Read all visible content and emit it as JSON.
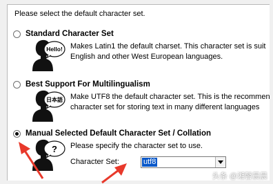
{
  "dialog": {
    "intro": "Please select the default character set."
  },
  "options": [
    {
      "title": "Standard Character Set",
      "bubble": "Hello!",
      "desc_line1": "Makes Latin1 the default charset. This character set is suit",
      "desc_line2": "English and other West European languages.",
      "selected": false
    },
    {
      "title": "Best Support For Multilingualism",
      "bubble": "日本語",
      "desc_line1": "Make UTF8 the default character set. This is the recommen",
      "desc_line2": "character set for storing text in many different languages",
      "selected": false
    },
    {
      "title": "Manual Selected Default Character Set / Collation",
      "bubble": "?",
      "desc_line1": "Please specify the character set to use.",
      "selected": true
    }
  ],
  "charset": {
    "label": "Character Set:",
    "value": "utf8"
  },
  "watermark": "头条 @湘警晨晨",
  "colors": {
    "annotation_arrow": "#e8392b",
    "selection": "#0a58c9"
  },
  "icons": {
    "person": "person-silhouette-icon",
    "dropdown": "chevron-down-icon"
  }
}
